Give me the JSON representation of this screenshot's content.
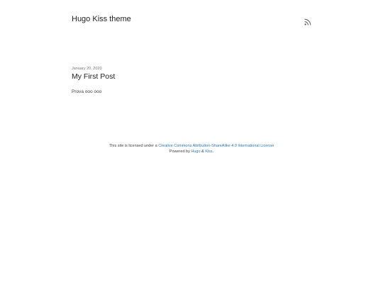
{
  "header": {
    "site_title": "Hugo Kiss theme",
    "rss_icon": "rss-icon"
  },
  "post": {
    "date": "January 20, 2020",
    "title": "My First Post",
    "summary": "Prova ooo ooo"
  },
  "footer": {
    "license_prefix": "This site is licensed under a ",
    "license_link": "Creative Commons Attribution-ShareAlike 4.0 International License",
    "powered_prefix": "Powered by ",
    "hugo_link": "Hugo",
    "amp": " & ",
    "kiss_link": "Kiss",
    "period": "."
  },
  "colors": {
    "link": "#2a7ab8",
    "text": "#333333",
    "muted": "#777777"
  }
}
